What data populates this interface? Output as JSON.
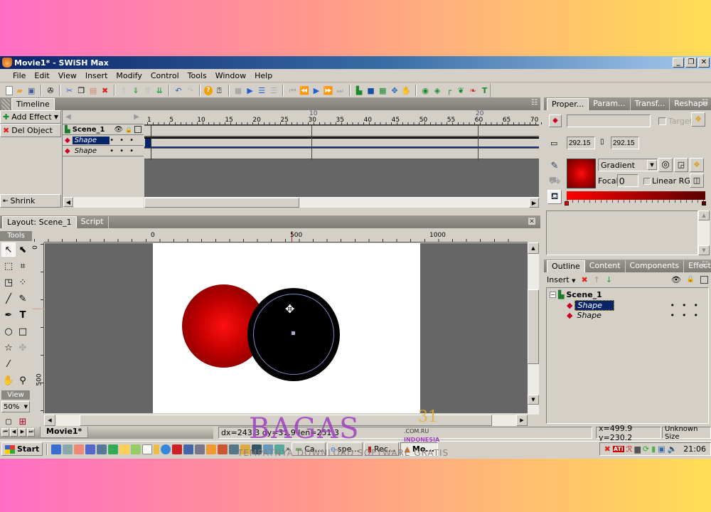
{
  "window": {
    "title": "Movie1* - SWiSH Max",
    "controls": [
      "_",
      "❐",
      "✕"
    ]
  },
  "menu": [
    "File",
    "Edit",
    "View",
    "Insert",
    "Modify",
    "Control",
    "Tools",
    "Window",
    "Help"
  ],
  "toolbar": {
    "groups": [
      [
        "new-file-icon",
        "open-folder-icon",
        "save-icon"
      ],
      [
        "preview-icon"
      ],
      [
        "cut-icon",
        "copy-icon",
        "paste-icon",
        "delete-icon"
      ],
      [
        "move-up-icon",
        "move-down-icon",
        "bring-front-icon",
        "send-back-icon"
      ],
      [
        "undo-icon",
        "redo-icon"
      ],
      [
        "help-icon",
        "whats-this-icon"
      ],
      [
        "stop-icon",
        "play-icon",
        "play-timeline-icon",
        "play-effect-icon"
      ],
      [
        "first-frame-icon",
        "prev-frame-icon",
        "play-frame-icon",
        "next-frame-icon",
        "last-frame-icon"
      ],
      [
        "insert-scene-icon",
        "insert-sprite-icon",
        "insert-movie-icon",
        "insert-button-icon",
        "insert-image-icon"
      ],
      [
        "insert-sound-icon",
        "insert-video-icon",
        "insert-path-icon",
        "insert-shape-icon",
        "insert-effect-icon",
        "insert-text-icon"
      ]
    ]
  },
  "timeline": {
    "tab": "Timeline",
    "add_effect": "Add Effect",
    "del_object": "Del Object",
    "shrink": "Shrink",
    "scene": "Scene_1",
    "layers": [
      {
        "name": "Shape",
        "selected": true
      },
      {
        "name": "Shape",
        "selected": false
      }
    ],
    "ruler_labels": [
      "1",
      "5",
      "10",
      "15",
      "20",
      "25",
      "30",
      "35",
      "40",
      "45",
      "50",
      "55",
      "60",
      "65",
      "70"
    ],
    "second_markers": [
      "10",
      "20"
    ]
  },
  "layout": {
    "tabs": [
      "Layout: Scene_1",
      "Script"
    ],
    "tools_label": "Tools",
    "view_label": "View",
    "zoom": "50%",
    "hruler_labels": [
      "0",
      "500",
      "1000"
    ],
    "vruler_labels": [
      "0",
      "500"
    ],
    "movie_tab": "Movie1*"
  },
  "properties": {
    "tabs": [
      "Proper...",
      "Param...",
      "Transf...",
      "Reshape"
    ],
    "name_value": "",
    "target_label": "Target",
    "width": "292.15",
    "height": "292.15",
    "fill_type": "Gradient",
    "focal_label": "Focal:",
    "focal_value": "0",
    "linear_rgb_label": "Linear RGB",
    "gradient_start": "#ff0000",
    "gradient_end": "#5a0000"
  },
  "outline": {
    "tabs": [
      "Outline",
      "Content",
      "Components",
      "Effect"
    ],
    "insert_label": "Insert",
    "scene": "Scene_1",
    "items": [
      {
        "name": "Shape",
        "selected": true
      },
      {
        "name": "Shape",
        "selected": false
      }
    ]
  },
  "status": {
    "measure": "dx=243.3 dy=31.9 len=251.3",
    "coords": "x=499.9 y=230.2",
    "size": "Unknown Size"
  },
  "taskbar": {
    "start": "Start",
    "tasks": [
      "Ca...",
      "spe...",
      "Rec...",
      "Mo..."
    ],
    "clock": "21:06"
  },
  "watermark": {
    "brand": "BAGAS",
    "number": "31",
    "domain": ".COM.RU",
    "country": "INDONESIA",
    "tagline": "TEMPATNYA DOWNLOAD SOFTWARE GRATIS"
  }
}
